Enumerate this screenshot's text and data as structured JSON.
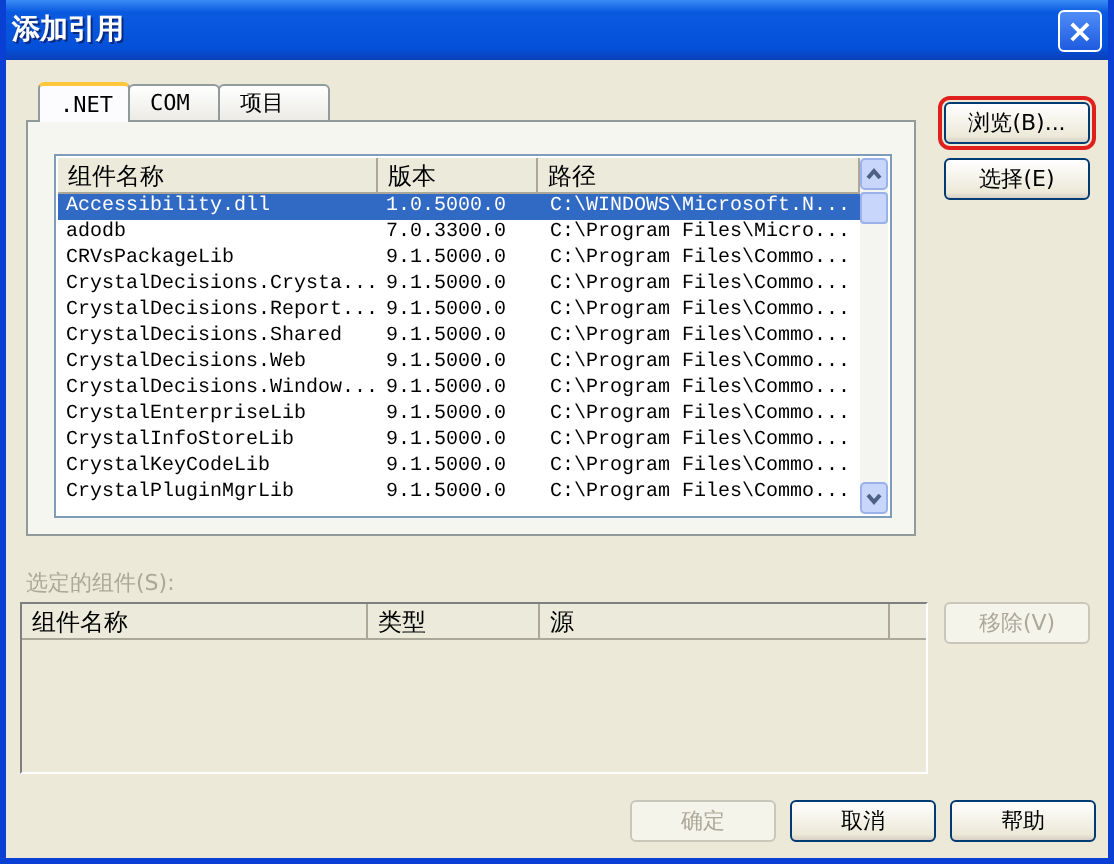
{
  "window": {
    "title": "添加引用",
    "close": "×"
  },
  "tabs": [
    {
      "label": ".NET",
      "selected": true
    },
    {
      "label": "COM",
      "selected": false
    },
    {
      "label": "项目",
      "selected": false
    }
  ],
  "components": {
    "columns": [
      "组件名称",
      "版本",
      "路径"
    ],
    "rows": [
      {
        "name": "Accessibility.dll",
        "version": "1.0.5000.0",
        "path": "C:\\WINDOWS\\Microsoft.N...",
        "selected": true
      },
      {
        "name": "adodb",
        "version": "7.0.3300.0",
        "path": "C:\\Program Files\\Micro...",
        "selected": false
      },
      {
        "name": "CRVsPackageLib",
        "version": "9.1.5000.0",
        "path": "C:\\Program Files\\Commo...",
        "selected": false
      },
      {
        "name": "CrystalDecisions.Crysta...",
        "version": "9.1.5000.0",
        "path": "C:\\Program Files\\Commo...",
        "selected": false
      },
      {
        "name": "CrystalDecisions.Report...",
        "version": "9.1.5000.0",
        "path": "C:\\Program Files\\Commo...",
        "selected": false
      },
      {
        "name": "CrystalDecisions.Shared",
        "version": "9.1.5000.0",
        "path": "C:\\Program Files\\Commo...",
        "selected": false
      },
      {
        "name": "CrystalDecisions.Web",
        "version": "9.1.5000.0",
        "path": "C:\\Program Files\\Commo...",
        "selected": false
      },
      {
        "name": "CrystalDecisions.Window...",
        "version": "9.1.5000.0",
        "path": "C:\\Program Files\\Commo...",
        "selected": false
      },
      {
        "name": "CrystalEnterpriseLib",
        "version": "9.1.5000.0",
        "path": "C:\\Program Files\\Commo...",
        "selected": false
      },
      {
        "name": "CrystalInfoStoreLib",
        "version": "9.1.5000.0",
        "path": "C:\\Program Files\\Commo...",
        "selected": false
      },
      {
        "name": "CrystalKeyCodeLib",
        "version": "9.1.5000.0",
        "path": "C:\\Program Files\\Commo...",
        "selected": false
      },
      {
        "name": "CrystalPluginMgrLib",
        "version": "9.1.5000.0",
        "path": "C:\\Program Files\\Commo...",
        "selected": false
      }
    ]
  },
  "side_buttons": [
    {
      "label": "浏览(B)...",
      "outlined": true,
      "disabled": false
    },
    {
      "label": "选择(E)",
      "outlined": false,
      "disabled": false
    }
  ],
  "selected_components": {
    "label": "选定的组件(S):",
    "disabled": true,
    "columns": [
      "组件名称",
      "类型",
      "源"
    ],
    "remove_button": {
      "label": "移除(V)",
      "disabled": true
    }
  },
  "buttons": [
    {
      "label": "确定",
      "disabled": true
    },
    {
      "label": "取消",
      "disabled": false
    },
    {
      "label": "帮助",
      "disabled": false
    }
  ]
}
